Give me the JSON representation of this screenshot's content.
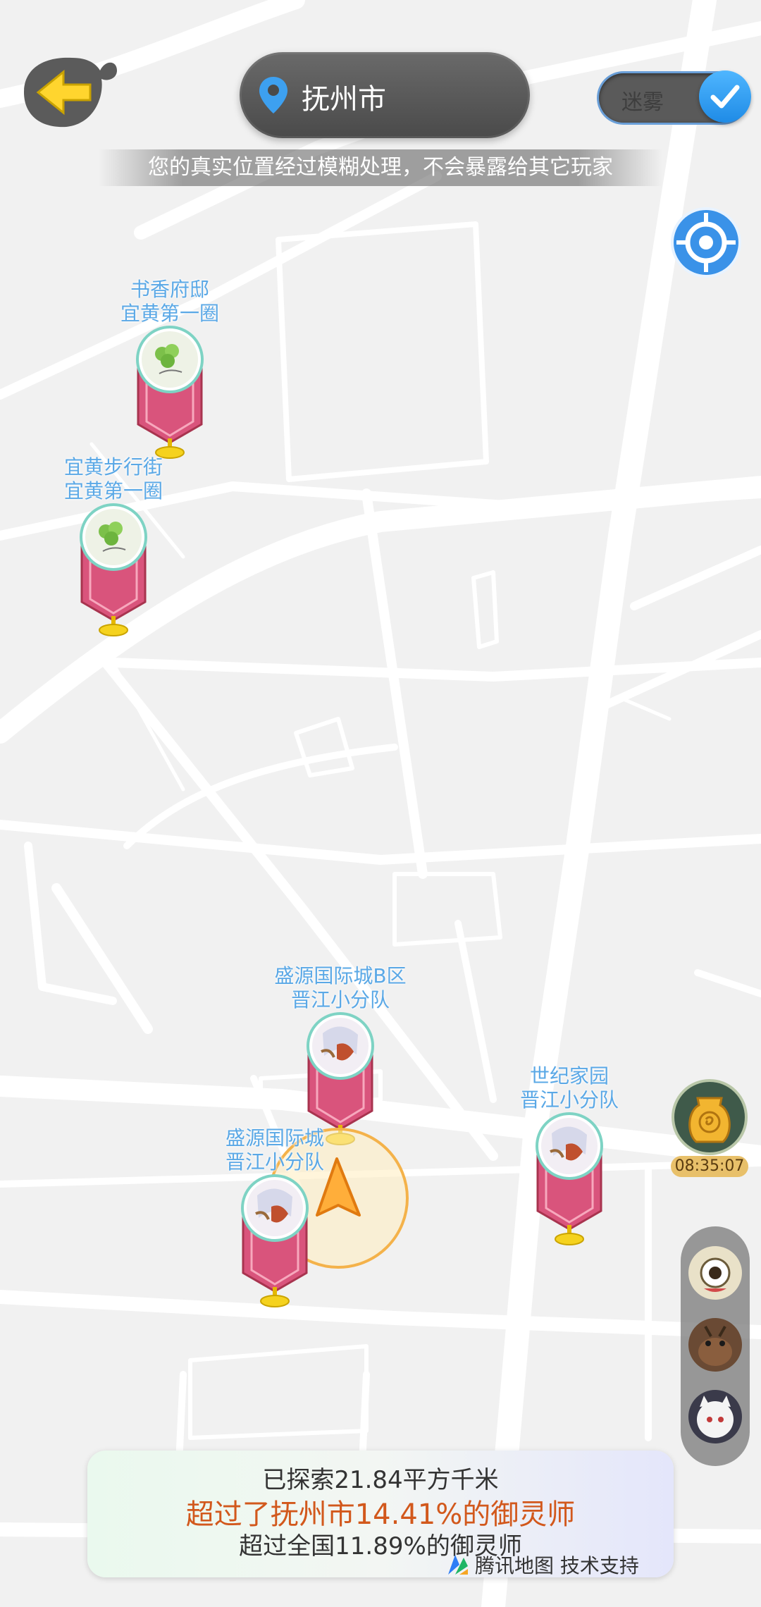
{
  "header": {
    "back_icon": "arrow-left-icon",
    "city": "抚州市",
    "location_icon": "location-pin-icon",
    "toggle_label": "迷雾",
    "toggle_checked": true,
    "notice": "您的真实位置经过模糊处理，不会暴露给其它玩家"
  },
  "pois": [
    {
      "name": "书香府邸",
      "team": "宜黄第一圈",
      "avatar": "clover"
    },
    {
      "name": "宜黄步行街",
      "team": "宜黄第一圈",
      "avatar": "clover"
    },
    {
      "name": "盛源国际城B区",
      "team": "晋江小分队",
      "avatar": "anime"
    },
    {
      "name": "世纪家园",
      "team": "晋江小分队",
      "avatar": "anime"
    },
    {
      "name": "盛源国际城",
      "team": "晋江小分队",
      "avatar": "anime"
    }
  ],
  "side": {
    "timer": "08:35:07",
    "shikigami": [
      "one-eyed-creature-icon",
      "brown-creature-icon",
      "white-cat-icon"
    ]
  },
  "stats": {
    "explored": "已探索21.84平方千米",
    "city_rank": "超过了抚州市14.41%的御灵师",
    "national_rank": "超过全国11.89%的御灵师"
  },
  "credit": {
    "logo": "tencent-map-logo",
    "text": "腾讯地图 技术支持"
  },
  "colors": {
    "accent_blue": "#1f8be6",
    "label_blue": "#5aa8e6",
    "banner_pink": "#d9547c",
    "rank_orange": "#d2581c"
  }
}
